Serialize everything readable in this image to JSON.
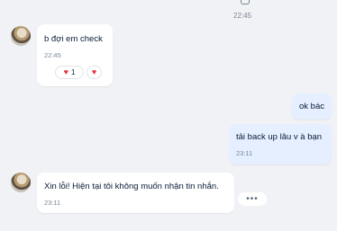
{
  "header": {
    "time": "22:45"
  },
  "messages": [
    {
      "direction": "in",
      "text": "b đợi em check",
      "time": "22:45",
      "reactions": [
        {
          "icon": "heart-icon",
          "count": "1"
        },
        {
          "icon": "heart-icon",
          "count": ""
        }
      ]
    },
    {
      "direction": "out",
      "text": "ok bác"
    },
    {
      "direction": "out",
      "text": "tải back up lâu v à bạn",
      "time": "23:11"
    },
    {
      "direction": "in",
      "text": "Xin lỗi! Hiện tại tôi không muốn nhận tin nhắn.",
      "time": "23:11"
    }
  ],
  "icons": {
    "heart": "♥",
    "more": "•••"
  },
  "colors": {
    "background": "#f0f2f5",
    "incoming": "#ffffff",
    "outgoing": "#e5efff",
    "heart": "#e8313f"
  }
}
